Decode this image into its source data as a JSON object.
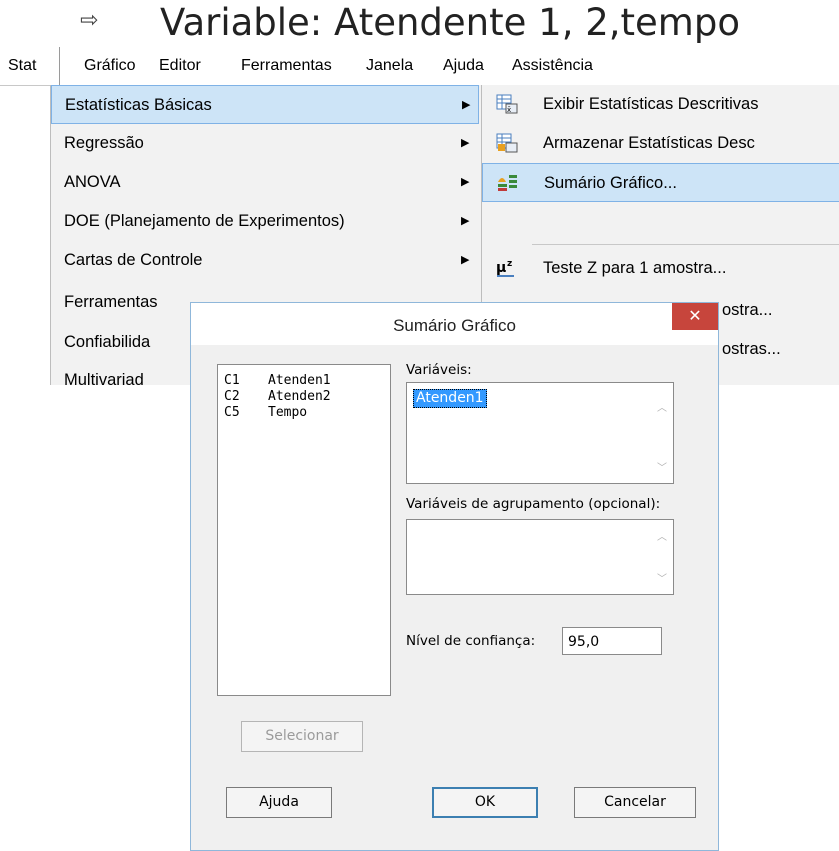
{
  "title": {
    "arrow": "⇨",
    "text": "Variable: Atendente 1, 2,tempo"
  },
  "menubar": {
    "items": [
      "Stat",
      "Gráfico",
      "Editor",
      "Ferramentas",
      "Janela",
      "Ajuda",
      "Assistência"
    ]
  },
  "stat_menu": {
    "items": [
      {
        "label": "Estatísticas Básicas",
        "arrow": "▶"
      },
      {
        "label": "Regressão",
        "arrow": "▶"
      },
      {
        "label": "ANOVA",
        "arrow": "▶"
      },
      {
        "label": "DOE (Planejamento de Experimentos)",
        "arrow": "▶"
      },
      {
        "label": "Cartas de Controle",
        "arrow": "▶"
      },
      {
        "label": "Ferramentas"
      },
      {
        "label": "Confiabilida"
      },
      {
        "label": "Multivariad"
      }
    ]
  },
  "sub_menu": {
    "items": [
      {
        "label": "Exibir Estatísticas Descritivas",
        "icon": "table-icon"
      },
      {
        "label": "Armazenar Estatísticas Desc",
        "icon": "store-table-icon"
      },
      {
        "label": "Sumário Gráfico...",
        "icon": "graph-summary-icon"
      },
      {
        "label": "Teste Z para 1 amostra...",
        "icon": "mu-z-icon"
      },
      {
        "label": "ostra..."
      },
      {
        "label": "ostras..."
      }
    ]
  },
  "dialog": {
    "title": "Sumário Gráfico",
    "close": "✕",
    "columns": [
      {
        "col": "C1",
        "name": "Atenden1"
      },
      {
        "col": "C2",
        "name": "Atenden2"
      },
      {
        "col": "C5",
        "name": "Tempo"
      }
    ],
    "variables_label": "Variáveis:",
    "variables_value": "Atenden1",
    "grouping_label": "Variáveis de agrupamento (opcional):",
    "confidence_label": "Nível de confiança:",
    "confidence_value": "95,0",
    "select_button": "Selecionar",
    "help_button": "Ajuda",
    "ok_button": "OK",
    "cancel_button": "Cancelar"
  }
}
